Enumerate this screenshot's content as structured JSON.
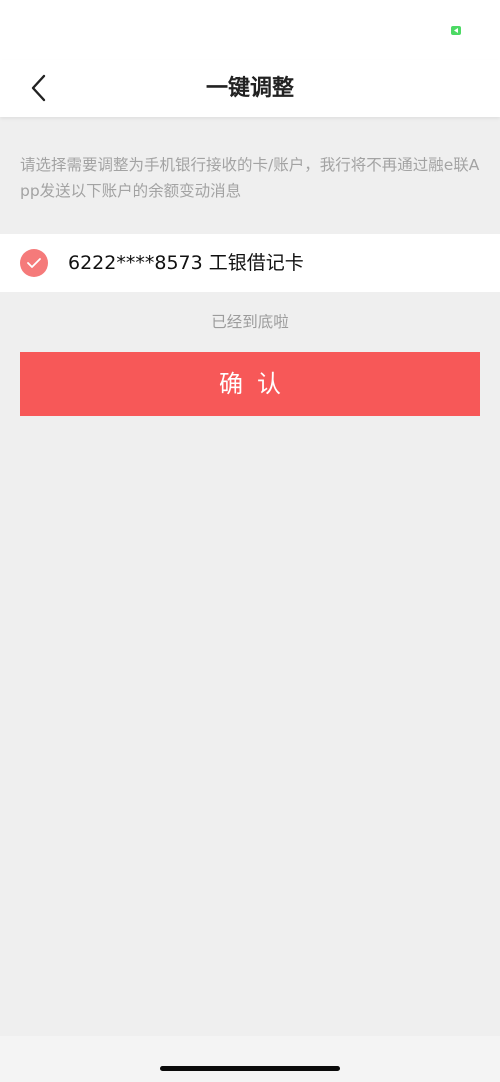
{
  "header": {
    "title": "一键调整"
  },
  "hint": {
    "text": "请选择需要调整为手机银行接收的卡/账户，我行将不再通过融e联App发送以下账户的余额变动消息"
  },
  "account": {
    "label": "6222****8573 工银借记卡",
    "checked": true
  },
  "list_end": {
    "text": "已经到底啦"
  },
  "confirm_button": {
    "label": "确认"
  },
  "colors": {
    "accent": "#f75858",
    "check": "#f57a7a",
    "battery": "#4cd964"
  }
}
